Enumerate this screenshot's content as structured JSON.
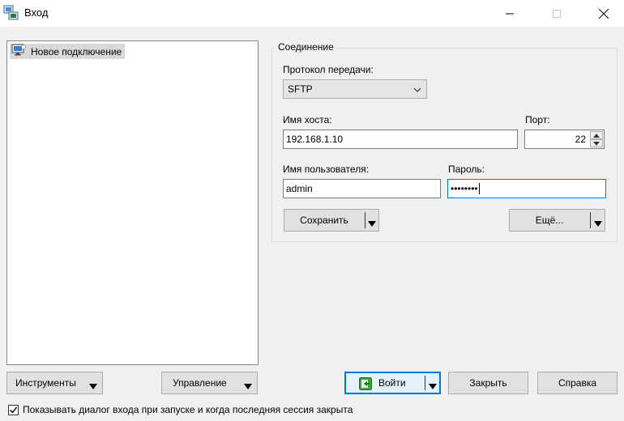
{
  "window": {
    "title": "Вход",
    "minimize_icon": "minimize-icon",
    "maximize_icon": "maximize-icon",
    "close_icon": "close-icon"
  },
  "sites": {
    "items": [
      {
        "label": "Новое подключение",
        "icon": "monitor-icon",
        "selected": true
      }
    ]
  },
  "session": {
    "group_title": "Соединение",
    "protocol_label": "Протокол передачи:",
    "protocol_value": "SFTP",
    "host_label": "Имя хоста:",
    "host_value": "192.168.1.10",
    "port_label": "Порт:",
    "port_value": "22",
    "user_label": "Имя пользователя:",
    "user_value": "admin",
    "password_label": "Пароль:",
    "password_value": "••••••••",
    "save_label": "Сохранить",
    "more_label": "Ещё..."
  },
  "footer": {
    "tools_label": "Инструменты",
    "manage_label": "Управление",
    "login_label": "Войти",
    "close_label": "Закрыть",
    "help_label": "Справка",
    "show_dialog_label": "Показывать диалог входа при запуске и когда последняя сессия закрыта",
    "show_dialog_checked": true
  },
  "colors": {
    "accent": "#0078d7",
    "window_bg": "#f0f0f0"
  }
}
